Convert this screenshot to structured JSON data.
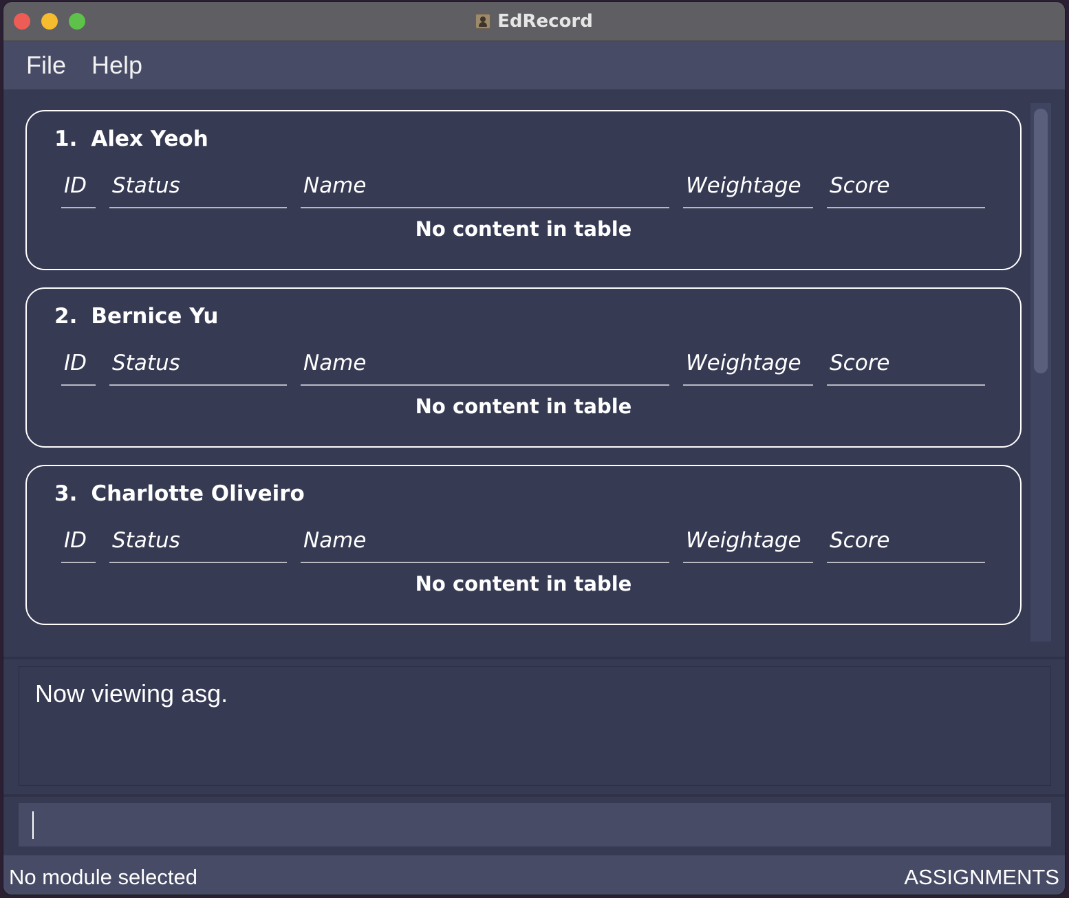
{
  "window": {
    "title": "EdRecord"
  },
  "menu": {
    "file": "File",
    "help": "Help"
  },
  "table_columns": [
    "ID",
    "Status",
    "Name",
    "Weightage",
    "Score"
  ],
  "empty_text": "No content in table",
  "students": [
    {
      "index": "1.",
      "name": "Alex Yeoh"
    },
    {
      "index": "2.",
      "name": "Bernice Yu"
    },
    {
      "index": "3.",
      "name": "Charlotte Oliveiro"
    }
  ],
  "result": {
    "message": "Now viewing asg."
  },
  "command": {
    "value": ""
  },
  "status": {
    "module": "No module selected",
    "view": "ASSIGNMENTS"
  }
}
